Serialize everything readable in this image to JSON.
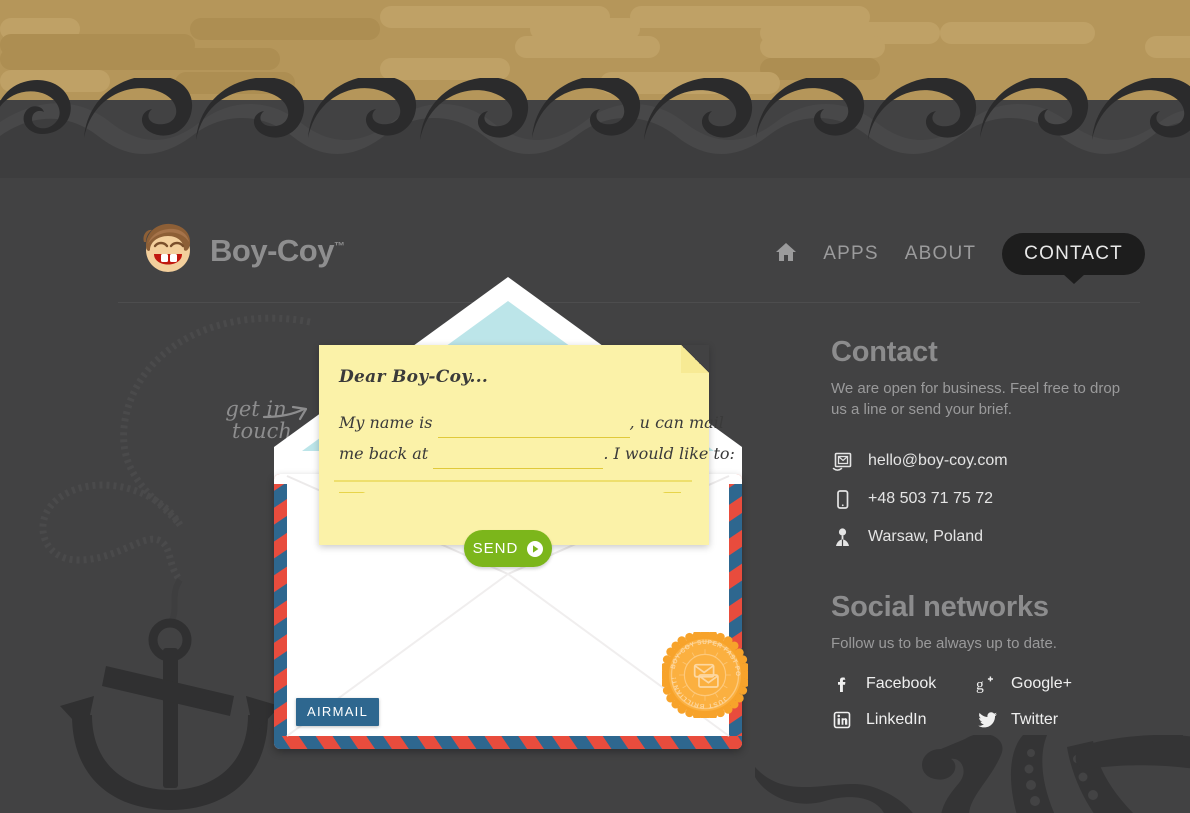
{
  "brand": {
    "name": "Boy-Coy",
    "tm": "™",
    "logo_icon": "boy-face-logo"
  },
  "nav": {
    "home_icon": "home-icon",
    "items": [
      {
        "label": "APPS",
        "name": "nav-apps"
      },
      {
        "label": "ABOUT",
        "name": "nav-about"
      }
    ],
    "active": {
      "label": "CONTACT",
      "name": "nav-contact"
    }
  },
  "hint": {
    "line1": "get in",
    "line2": "touch",
    "arrow_icon": "curved-arrow-icon"
  },
  "letter": {
    "salutation": "Dear Boy-Coy...",
    "line1_pre": "My name is",
    "line1_post": ", u can mail",
    "line2_pre": "me back at",
    "line2_post": ". I would like to:",
    "name_value": "",
    "email_value": "",
    "name_placeholder": "",
    "email_placeholder": ""
  },
  "send": {
    "label": "SEND",
    "icon": "play-circle-icon",
    "color": "#7cb61b"
  },
  "envelope": {
    "airmail_label": "AIRMAIL",
    "airmail_color": "#2e678f",
    "stripe_red": "#e84c3d",
    "stripe_blue": "#2e678f",
    "paper_color": "#fbf2a8"
  },
  "seal": {
    "top_text": "BOY-COY SUPER FAST POSTAL SERVICE",
    "bottom_text": "JUST BRILLIANT!",
    "icon": "mail-stack-icon",
    "color": "#f5a026"
  },
  "sidebar": {
    "contact": {
      "title": "Contact",
      "description": "We are open for business. Feel free to drop us a line or send your brief.",
      "items": [
        {
          "icon": "stamp-icon",
          "text": "hello@boy-coy.com",
          "name": "contact-email"
        },
        {
          "icon": "mobile-phone-icon",
          "text": "+48 503 71 75 72",
          "name": "contact-phone"
        },
        {
          "icon": "map-pin-icon",
          "text": "Warsaw, Poland",
          "name": "contact-location"
        }
      ]
    },
    "social": {
      "title": "Social networks",
      "description": "Follow us to be always up to date.",
      "items": [
        {
          "icon": "facebook-icon",
          "label": "Facebook",
          "name": "social-facebook"
        },
        {
          "icon": "google-plus-icon",
          "label": "Google+",
          "name": "social-googleplus"
        },
        {
          "icon": "linkedin-icon",
          "label": "LinkedIn",
          "name": "social-linkedin"
        },
        {
          "icon": "twitter-icon",
          "label": "Twitter",
          "name": "social-twitter"
        }
      ]
    }
  },
  "theme": {
    "sky": "#b5965a",
    "water": "#424243",
    "wave_dark": "#2c2c2d",
    "wave_mid": "#393939",
    "heading_gray": "#8c8c8d"
  },
  "decor": {
    "anchor": "anchor-rope-icon",
    "octopus": "octopus-tentacles-icon"
  }
}
